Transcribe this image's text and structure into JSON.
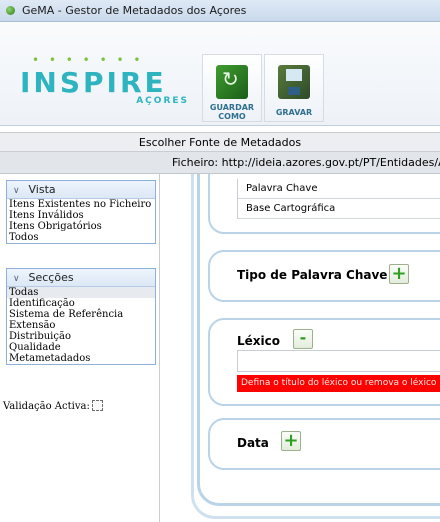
{
  "window": {
    "title": "GeMA - Gestor de Metadados dos Açores"
  },
  "logo": {
    "main": "INSPIRE",
    "sub": "AÇORES"
  },
  "toolbar": {
    "save_as": {
      "label_line1": "GUARDAR",
      "label_line2": "COMO",
      "icon": "save-as-icon"
    },
    "save": {
      "label": "GRAVAR",
      "icon": "floppy-disk-icon"
    }
  },
  "source_bar": {
    "label": "Escolher Fonte de Metadados"
  },
  "file_bar": {
    "label": "Ficheiro: http://ideia.azores.gov.pt/PT/Entidades/AM"
  },
  "sidebar": {
    "vista": {
      "title": "Vista",
      "items": [
        "Itens Existentes no Ficheiro",
        "Itens Inválidos",
        "Itens Obrigatórios",
        "Todos"
      ]
    },
    "seccoes": {
      "title": "Secções",
      "items": [
        "Todas",
        "Identificação",
        "Sistema de Referência",
        "Extensão",
        "Distribuição",
        "Qualidade",
        "Metametadados"
      ],
      "selected": "Todas"
    },
    "validation": {
      "label": "Validação Activa:"
    }
  },
  "main": {
    "keywords": [
      "Palavra Chave",
      "Base Cartográfica"
    ],
    "keyword_type": {
      "title": "Tipo de Palavra Chave",
      "button": "+"
    },
    "lexicon": {
      "title": "Léxico",
      "button": "-",
      "error": "Defina o título do léxico ou remova o léxico"
    },
    "date": {
      "title": "Data",
      "button": "+"
    }
  },
  "colors": {
    "accent": "#2db4bf",
    "error": "#ff0000",
    "add_green": "#2f9e22",
    "frame": "#b9d4e8"
  }
}
